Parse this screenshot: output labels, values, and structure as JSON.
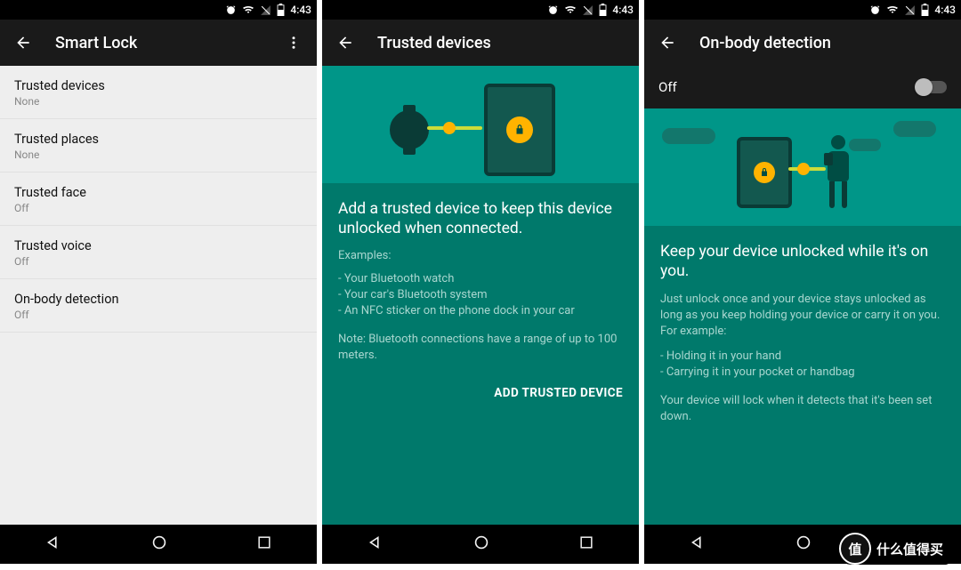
{
  "status": {
    "time": "4:43"
  },
  "p1": {
    "title": "Smart Lock",
    "items": [
      {
        "title": "Trusted devices",
        "sub": "None"
      },
      {
        "title": "Trusted places",
        "sub": "None"
      },
      {
        "title": "Trusted face",
        "sub": "Off"
      },
      {
        "title": "Trusted voice",
        "sub": "Off"
      },
      {
        "title": "On-body detection",
        "sub": "Off"
      }
    ]
  },
  "p2": {
    "title": "Trusted devices",
    "headline": "Add a trusted device to keep this device unlocked when connected.",
    "examples_label": "Examples:",
    "ex1": "- Your Bluetooth watch",
    "ex2": "- Your car's Bluetooth system",
    "ex3": "- An NFC sticker on the phone dock in your car",
    "note": "Note: Bluetooth connections have a range of up to 100 meters.",
    "add_btn": "ADD TRUSTED DEVICE"
  },
  "p3": {
    "title": "On-body detection",
    "toggle_label": "Off",
    "headline": "Keep your device unlocked while it's on you.",
    "desc": "Just unlock once and your device stays unlocked as long as you keep holding your device or carry it on you. For example:",
    "ex1": "- Holding it in your hand",
    "ex2": "- Carrying it in your pocket or handbag",
    "note": "Your device will lock when it detects that it's been set down."
  },
  "watermark": {
    "glyph": "值",
    "text": "什么值得买"
  }
}
